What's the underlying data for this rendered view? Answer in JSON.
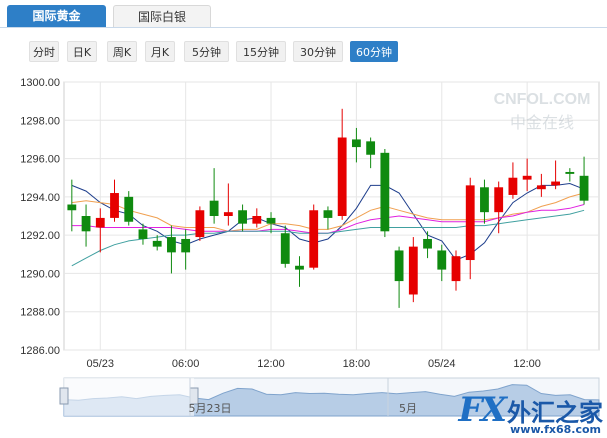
{
  "tabs": [
    {
      "label": "国际黄金",
      "active": true
    },
    {
      "label": "国际白银",
      "active": false
    }
  ],
  "periods": [
    {
      "label": "分时",
      "active": false
    },
    {
      "label": "日K",
      "active": false
    },
    {
      "label": "周K",
      "active": false
    },
    {
      "label": "月K",
      "active": false
    },
    {
      "label": "5分钟",
      "active": false
    },
    {
      "label": "15分钟",
      "active": false
    },
    {
      "label": "30分钟",
      "active": false
    },
    {
      "label": "60分钟",
      "active": true
    }
  ],
  "watermark": {
    "text1": "CNFOL.COM",
    "text2": "中金在线"
  },
  "brand": {
    "fx": "FX",
    "cn": "外汇之家",
    "url": "www.fx68.com"
  },
  "colors": {
    "up": "#e60000",
    "down": "#0f8a0f",
    "ma5": "#1e3e8c",
    "ma10": "#f0a050",
    "ma20": "#e020e0",
    "ma30": "#40a0a0"
  },
  "chart_data": {
    "type": "candlestick",
    "ylim": [
      1286.0,
      1300.0
    ],
    "yticks": [
      "1300.00",
      "1298.00",
      "1296.00",
      "1294.00",
      "1292.00",
      "1290.00",
      "1288.00",
      "1286.00"
    ],
    "xtick_labels": [
      "05/23",
      "06:00",
      "12:00",
      "18:00",
      "05/24",
      "12:00"
    ],
    "xtick_index": [
      2,
      8,
      14,
      20,
      26,
      32
    ],
    "grid": true,
    "candles": [
      {
        "o": 1293.6,
        "c": 1293.3,
        "h": 1294.9,
        "l": 1292.2
      },
      {
        "o": 1293.0,
        "c": 1292.2,
        "h": 1293.6,
        "l": 1291.4
      },
      {
        "o": 1292.4,
        "c": 1292.9,
        "h": 1293.4,
        "l": 1291.1
      },
      {
        "o": 1292.9,
        "c": 1294.2,
        "h": 1294.9,
        "l": 1292.7
      },
      {
        "o": 1294.0,
        "c": 1292.7,
        "h": 1294.3,
        "l": 1292.5
      },
      {
        "o": 1292.3,
        "c": 1291.8,
        "h": 1292.6,
        "l": 1291.5
      },
      {
        "o": 1291.7,
        "c": 1291.4,
        "h": 1292.0,
        "l": 1291.2
      },
      {
        "o": 1291.9,
        "c": 1291.1,
        "h": 1292.5,
        "l": 1290.0
      },
      {
        "o": 1291.8,
        "c": 1291.1,
        "h": 1292.3,
        "l": 1290.2
      },
      {
        "o": 1291.9,
        "c": 1293.3,
        "h": 1293.5,
        "l": 1291.7
      },
      {
        "o": 1293.8,
        "c": 1293.0,
        "h": 1295.5,
        "l": 1292.6
      },
      {
        "o": 1293.0,
        "c": 1293.2,
        "h": 1294.7,
        "l": 1292.5
      },
      {
        "o": 1293.3,
        "c": 1292.6,
        "h": 1293.6,
        "l": 1292.2
      },
      {
        "o": 1292.6,
        "c": 1293.0,
        "h": 1293.4,
        "l": 1292.4
      },
      {
        "o": 1292.9,
        "c": 1292.6,
        "h": 1293.2,
        "l": 1292.1
      },
      {
        "o": 1292.1,
        "c": 1290.5,
        "h": 1292.5,
        "l": 1290.3
      },
      {
        "o": 1290.4,
        "c": 1290.2,
        "h": 1290.9,
        "l": 1289.3
      },
      {
        "o": 1290.3,
        "c": 1293.3,
        "h": 1293.6,
        "l": 1290.2
      },
      {
        "o": 1293.3,
        "c": 1292.9,
        "h": 1293.5,
        "l": 1292.3
      },
      {
        "o": 1293.0,
        "c": 1297.1,
        "h": 1298.6,
        "l": 1292.8
      },
      {
        "o": 1297.0,
        "c": 1296.6,
        "h": 1297.6,
        "l": 1295.8
      },
      {
        "o": 1296.9,
        "c": 1296.2,
        "h": 1297.1,
        "l": 1295.5
      },
      {
        "o": 1296.3,
        "c": 1292.2,
        "h": 1296.5,
        "l": 1291.9
      },
      {
        "o": 1291.2,
        "c": 1289.6,
        "h": 1291.4,
        "l": 1288.2
      },
      {
        "o": 1288.9,
        "c": 1291.4,
        "h": 1291.9,
        "l": 1288.5
      },
      {
        "o": 1291.8,
        "c": 1291.3,
        "h": 1292.2,
        "l": 1290.8
      },
      {
        "o": 1291.2,
        "c": 1290.2,
        "h": 1291.5,
        "l": 1289.6
      },
      {
        "o": 1289.6,
        "c": 1290.9,
        "h": 1291.2,
        "l": 1289.1
      },
      {
        "o": 1290.7,
        "c": 1294.6,
        "h": 1295.0,
        "l": 1289.7
      },
      {
        "o": 1294.5,
        "c": 1293.2,
        "h": 1294.9,
        "l": 1292.6
      },
      {
        "o": 1293.2,
        "c": 1294.5,
        "h": 1294.8,
        "l": 1292.1
      },
      {
        "o": 1294.1,
        "c": 1295.0,
        "h": 1295.8,
        "l": 1293.9
      },
      {
        "o": 1294.9,
        "c": 1295.1,
        "h": 1296.0,
        "l": 1294.3
      },
      {
        "o": 1294.4,
        "c": 1294.6,
        "h": 1295.2,
        "l": 1294.0
      },
      {
        "o": 1294.6,
        "c": 1294.8,
        "h": 1295.9,
        "l": 1294.4
      },
      {
        "o": 1295.3,
        "c": 1295.2,
        "h": 1295.5,
        "l": 1294.8
      },
      {
        "o": 1295.1,
        "c": 1293.8,
        "h": 1296.1,
        "l": 1293.6
      }
    ],
    "series": [
      {
        "values": [
          1294.6,
          1294.3,
          1293.7,
          1293.3,
          1293.1,
          1292.5,
          1292.2,
          1291.7,
          1291.5,
          1291.8,
          1292.0,
          1292.2,
          1292.8,
          1292.9,
          1292.6,
          1292.4,
          1291.8,
          1291.6,
          1291.8,
          1292.5,
          1293.4,
          1294.6,
          1294.6,
          1294.2,
          1293.1,
          1292.0,
          1291.7,
          1290.7,
          1291.0,
          1291.6,
          1292.7,
          1293.7,
          1294.2,
          1294.6,
          1294.6,
          1294.7,
          1294.4
        ]
      },
      {
        "values": [
          1293.7,
          1293.8,
          1293.7,
          1293.6,
          1293.3,
          1293.1,
          1292.9,
          1292.5,
          1292.4,
          1292.4,
          1292.4,
          1292.2,
          1292.3,
          1292.3,
          1292.6,
          1292.6,
          1292.5,
          1292.3,
          1292.3,
          1292.5,
          1292.9,
          1293.3,
          1293.5,
          1293.3,
          1293.1,
          1292.9,
          1292.8,
          1292.8,
          1292.8,
          1292.8,
          1292.9,
          1293.1,
          1293.2,
          1293.5,
          1293.7,
          1294.0,
          1294.2
        ]
      },
      {
        "values": [
          1292.5,
          1292.5,
          1292.4,
          1292.4,
          1292.4,
          1292.4,
          1292.4,
          1292.4,
          1292.3,
          1292.2,
          1292.2,
          1292.2,
          1292.2,
          1292.2,
          1292.3,
          1292.3,
          1292.2,
          1292.1,
          1292.1,
          1292.3,
          1292.6,
          1292.8,
          1292.9,
          1293.0,
          1292.9,
          1292.8,
          1292.7,
          1292.7,
          1292.7,
          1292.7,
          1292.9,
          1293.0,
          1293.2,
          1293.3,
          1293.3,
          1293.4,
          1293.6
        ]
      },
      {
        "values": [
          1290.4,
          1290.8,
          1291.2,
          1291.5,
          1291.7,
          1291.8,
          1291.9,
          1292.0,
          1292.0,
          1292.1,
          1292.1,
          1292.2,
          1292.2,
          1292.2,
          1292.2,
          1292.2,
          1292.1,
          1292.1,
          1292.1,
          1292.2,
          1292.3,
          1292.4,
          1292.4,
          1292.4,
          1292.4,
          1292.4,
          1292.4,
          1292.4,
          1292.5,
          1292.5,
          1292.6,
          1292.7,
          1292.8,
          1292.9,
          1293.0,
          1293.1,
          1293.3
        ]
      }
    ],
    "navigator": {
      "labels": [
        "5月23日",
        "5月"
      ],
      "values": [
        0.55,
        0.57,
        0.52,
        0.5,
        0.46,
        0.52,
        0.45,
        0.42,
        0.4,
        0.5,
        0.55,
        0.35,
        0.2,
        0.22,
        0.38,
        0.4,
        0.33,
        0.36,
        0.35,
        0.38,
        0.4,
        0.36,
        0.33,
        0.37,
        0.33,
        0.3,
        0.38,
        0.45,
        0.32,
        0.28,
        0.22,
        0.08,
        0.1,
        0.36,
        0.42,
        0.4,
        0.55,
        0.56
      ]
    }
  }
}
